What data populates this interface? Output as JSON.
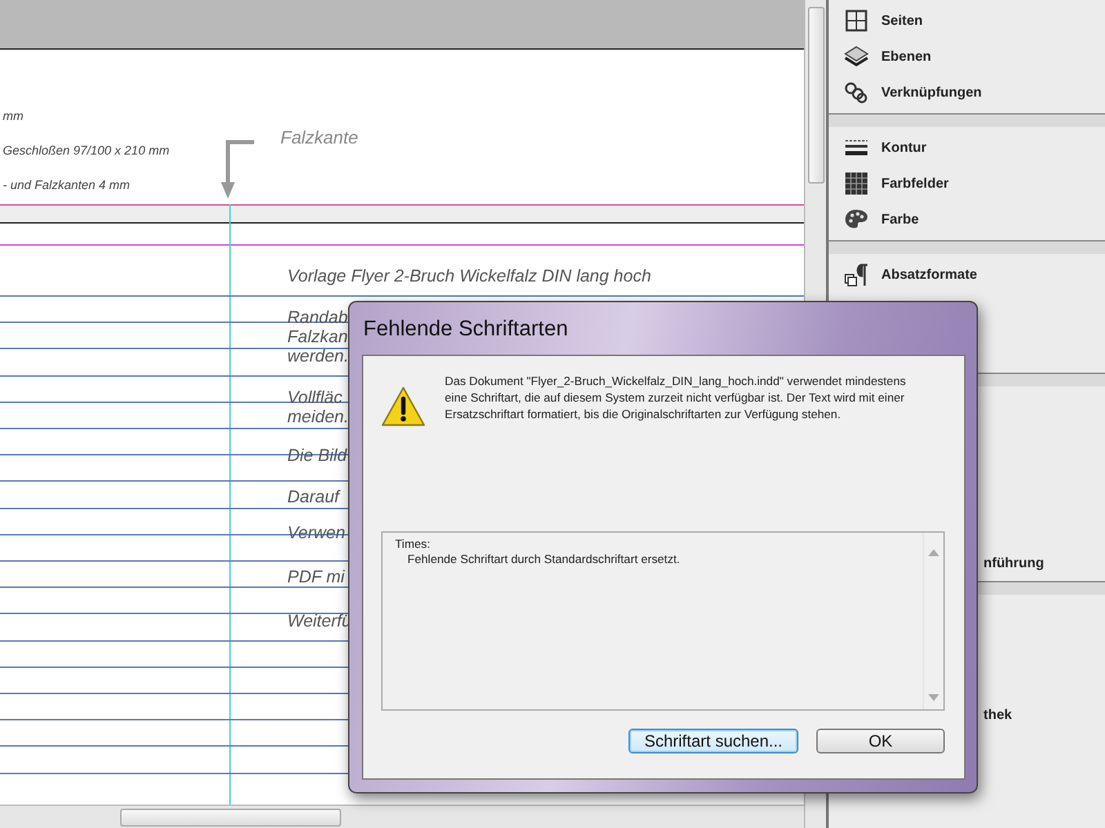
{
  "document": {
    "header_lines": [
      "mm",
      "Geschloßen 97/100 x 210 mm",
      "- und Falzkanten 4 mm"
    ],
    "fold_label": "Falzkante",
    "body_lines": [
      "Vorlage Flyer 2-Bruch Wickelfalz  DIN lang hoch",
      "Randab",
      "Falzkan",
      "werden.",
      "Vollfläc",
      "meiden.",
      "Die Bild",
      "Darauf",
      "Verwen",
      "PDF mi",
      "Weiterfü"
    ]
  },
  "panel": {
    "groups": [
      {
        "items": [
          "Seiten",
          "Ebenen",
          "Verknüpfungen"
        ]
      },
      {
        "items": [
          "Kontur",
          "Farbfelder",
          "Farbe"
        ]
      },
      {
        "items": [
          "Absatzformate"
        ]
      },
      {
        "items": [
          "nführung"
        ]
      },
      {
        "items": [
          "thek"
        ]
      }
    ]
  },
  "dialog": {
    "title": "Fehlende Schriftarten",
    "message": "Das Dokument \"Flyer_2-Bruch_Wickelfalz_DIN_lang_hoch.indd\" verwendet mindestens eine Schriftart, die auf diesem System zurzeit nicht verfügbar ist. Der Text wird mit einer Ersatzschriftart formatiert, bis die Originalschriftarten zur Verfügung stehen.",
    "list": [
      {
        "font": "Times:",
        "note": "Fehlende Schriftart durch Standardschriftart ersetzt."
      }
    ],
    "buttons": [
      {
        "label": "Schriftart suchen...",
        "focused": true
      },
      {
        "label": "OK",
        "focused": false
      }
    ]
  }
}
